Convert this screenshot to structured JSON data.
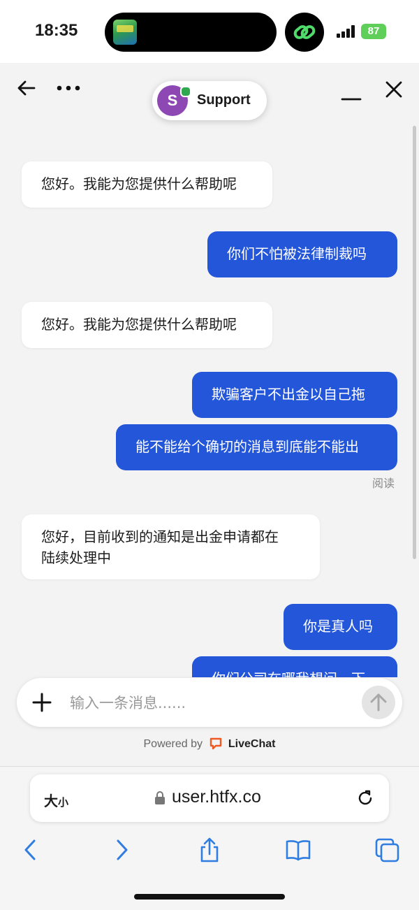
{
  "status_bar": {
    "time": "18:35",
    "battery": "87"
  },
  "chat": {
    "agent_name": "Support",
    "avatar_letter": "S",
    "messages": [
      {
        "from": "agent",
        "text": "您好。我能为您提供什么帮助呢"
      },
      {
        "from": "user",
        "text": "你们不怕被法律制裁吗"
      },
      {
        "from": "agent",
        "text": "您好。我能为您提供什么帮助呢"
      },
      {
        "from": "user",
        "text": "欺骗客户不出金以自己拖"
      },
      {
        "from": "user",
        "text": "能不能给个确切的消息到底能不能出"
      },
      {
        "from": "agent",
        "text": "您好，目前收到的通知是出金申请都在",
        "text2": "陆续处理中"
      },
      {
        "from": "user",
        "text": "你是真人吗"
      },
      {
        "from": "user",
        "text": "你们公司在哪我想问一下"
      }
    ],
    "read_receipt": "阅读"
  },
  "composer": {
    "placeholder": "输入一条消息......",
    "value": ""
  },
  "powered_by": {
    "label": "Powered by",
    "brand": "LiveChat"
  },
  "browser": {
    "text_size_label": "大",
    "text_size_small": "小",
    "url": "user.htfx.co"
  },
  "colors": {
    "user_bubble": "#2456d9",
    "agent_bubble": "#ffffff",
    "accent": "#2f7de1",
    "avatar": "#8e48b3"
  }
}
